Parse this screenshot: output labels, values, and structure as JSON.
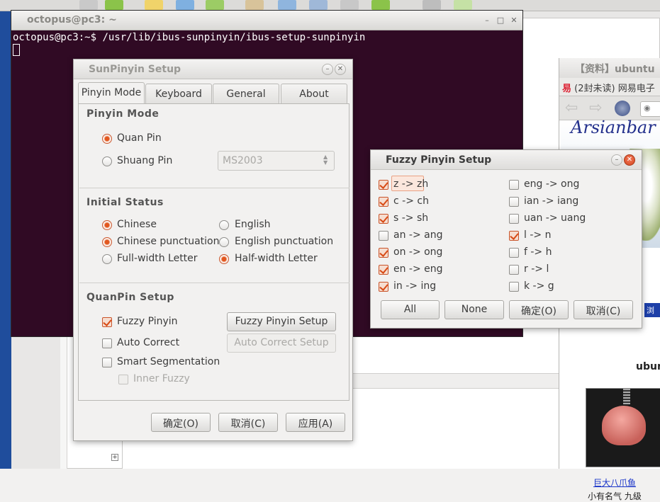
{
  "terminal": {
    "title": "octopus@pc3: ~",
    "prompt": "octopus@pc3:~$ ",
    "command": "/usr/lib/ibus-sunpinyin/ibus-setup-sunpinyin"
  },
  "sunpinyin": {
    "title": "SunPinyin Setup",
    "tabs": [
      "Pinyin Mode",
      "Keyboard",
      "General",
      "About"
    ],
    "active_tab": "Pinyin Mode",
    "pinyin_mode": {
      "heading": "Pinyin Mode",
      "quan_pin": "Quan Pin",
      "shuang_pin": "Shuang Pin",
      "selected": "Quan Pin",
      "shuang_scheme": "MS2003"
    },
    "initial_status": {
      "heading": "Initial Status",
      "chinese": "Chinese",
      "english": "English",
      "chinese_punct": "Chinese punctuation",
      "english_punct": "English punctuation",
      "full_width": "Full-width Letter",
      "half_width": "Half-width Letter"
    },
    "quanpin_setup": {
      "heading": "QuanPin Setup",
      "fuzzy": "Fuzzy Pinyin",
      "fuzzy_button": "Fuzzy Pinyin Setup",
      "auto_correct": "Auto Correct",
      "auto_correct_button": "Auto Correct Setup",
      "smart_seg": "Smart Segmentation",
      "inner_fuzzy": "Inner Fuzzy"
    },
    "buttons": {
      "ok": "确定(O)",
      "cancel": "取消(C)",
      "apply": "应用(A)"
    }
  },
  "fuzzy": {
    "title": "Fuzzy Pinyin Setup",
    "left_options": [
      {
        "label": "z -> zh",
        "checked": true
      },
      {
        "label": "c -> ch",
        "checked": true
      },
      {
        "label": "s -> sh",
        "checked": true
      },
      {
        "label": "an -> ang",
        "checked": false
      },
      {
        "label": "on -> ong",
        "checked": true
      },
      {
        "label": "en -> eng",
        "checked": true
      },
      {
        "label": "in -> ing",
        "checked": true
      }
    ],
    "right_options": [
      {
        "label": "eng -> ong",
        "checked": false
      },
      {
        "label": "ian -> iang",
        "checked": false
      },
      {
        "label": "uan -> uang",
        "checked": false
      },
      {
        "label": "l -> n",
        "checked": true
      },
      {
        "label": "f -> h",
        "checked": false
      },
      {
        "label": "r -> l",
        "checked": false
      },
      {
        "label": "k -> g",
        "checked": false
      }
    ],
    "buttons": {
      "all": "All",
      "none": "None",
      "ok": "确定(O)",
      "cancel": "取消(C)"
    }
  },
  "browser": {
    "title": "【资料】ubuntu",
    "tab": "(2封未读) 网易电子",
    "banner_text": "Arsianbar",
    "strip_text": "浏览",
    "section_heading": "ubuntu",
    "octo_link": "巨大八爪鱼",
    "octo_caption": "小有名气 九级"
  },
  "colors": {
    "accent": "#e2571f",
    "terminal_bg": "#300a24",
    "dialog_bg": "#f2f1f0"
  }
}
